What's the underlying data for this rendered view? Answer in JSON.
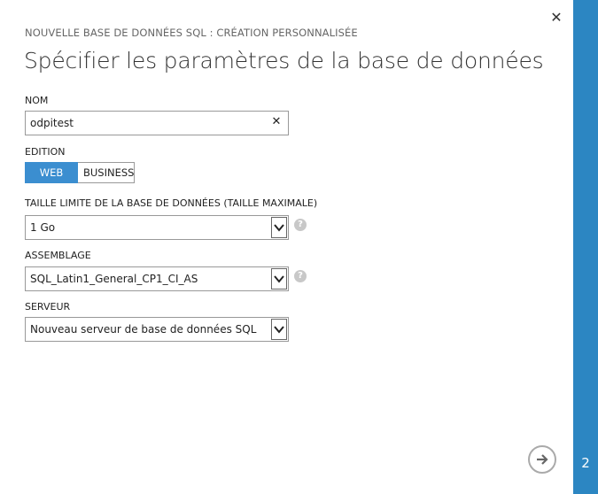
{
  "dialog": {
    "overline": "NOUVELLE BASE DE DONNÉES SQL : CRÉATION PERSONNALISÉE",
    "title": "Spécifier les paramètres de la base de données",
    "close_icon": "close-icon"
  },
  "fields": {
    "name": {
      "label": "NOM",
      "value": "odpitest",
      "clear_icon": "clear-icon"
    },
    "edition": {
      "label": "EDITION",
      "options": [
        "WEB",
        "BUSINESS"
      ],
      "selected": "WEB"
    },
    "size": {
      "label": "TAILLE LIMITE DE LA BASE DE DONNÉES (TAILLE MAXIMALE)",
      "value": "1 Go"
    },
    "collation": {
      "label": "ASSEMBLAGE",
      "value": "SQL_Latin1_General_CP1_CI_AS"
    },
    "server": {
      "label": "SERVEUR",
      "value": "Nouveau serveur de base de données SQL"
    }
  },
  "help_icon": "?",
  "footer": {
    "next_icon": "arrow-right-circle-icon"
  },
  "wizard": {
    "step": "2"
  },
  "colors": {
    "accent": "#3b8ed0",
    "rail": "#2c86c2"
  }
}
